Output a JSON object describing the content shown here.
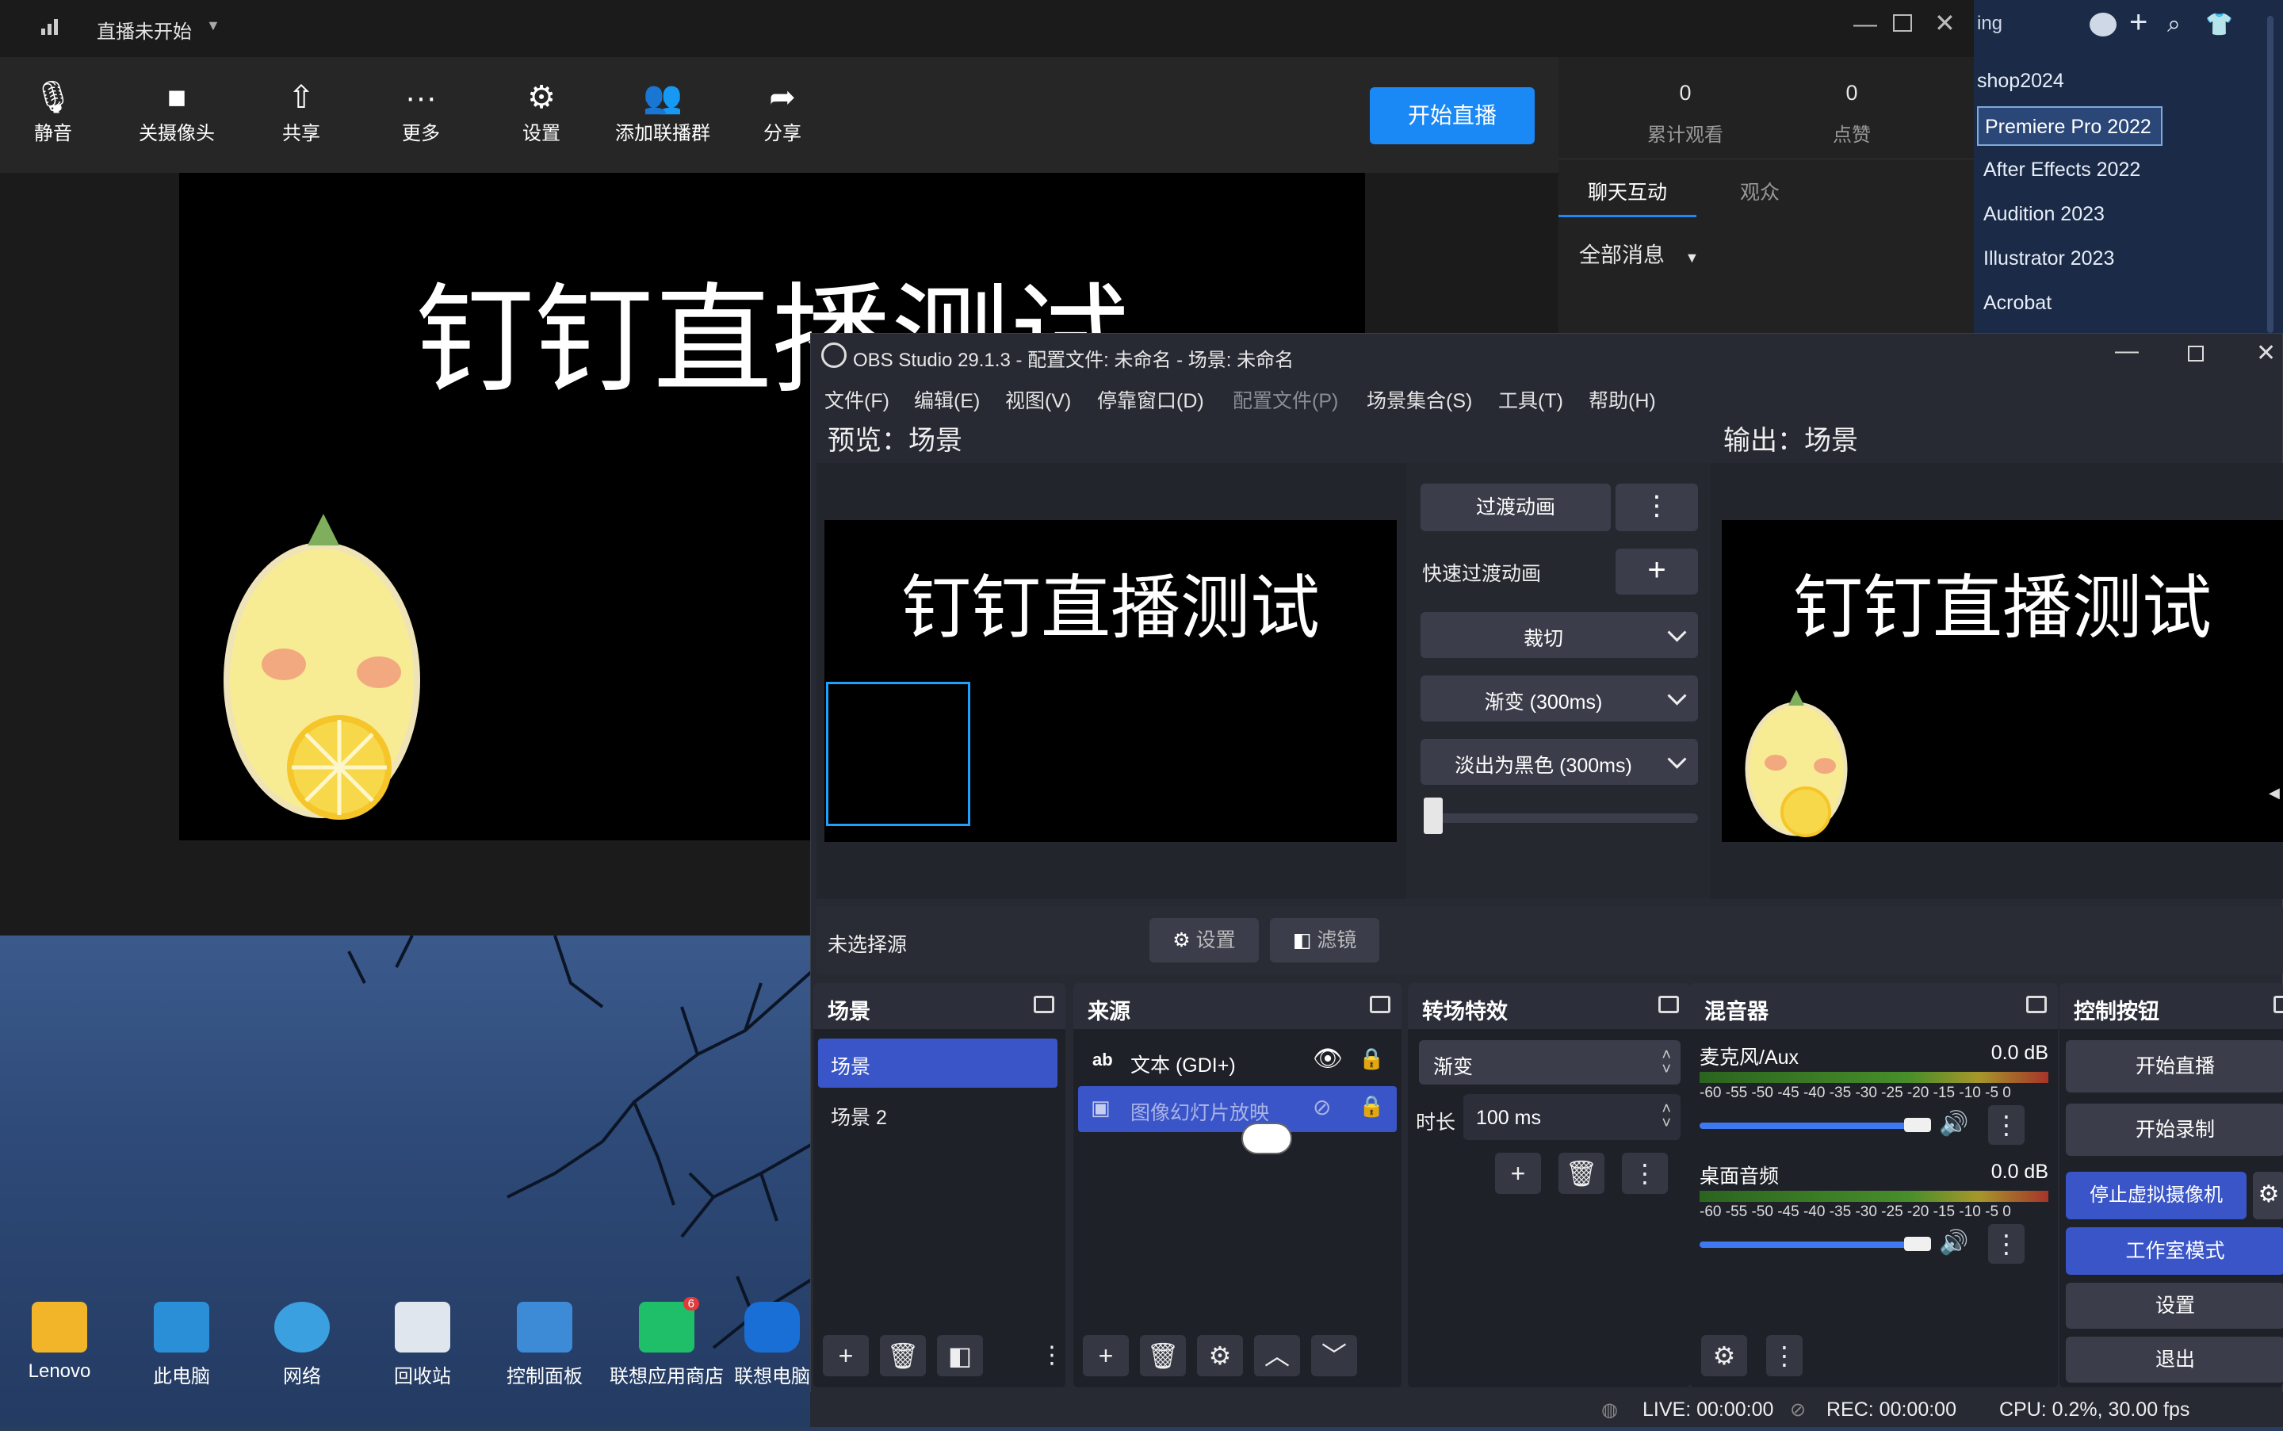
{
  "ding": {
    "status": "直播未开始",
    "toolbar": {
      "mute": "静音",
      "camera": "关摄像头",
      "share": "共享",
      "more": "更多",
      "settings": "设置",
      "add_cohost": "添加联播群",
      "share_out": "分享"
    },
    "start_live": "开始直播",
    "stats": {
      "views_value": "0",
      "views_label": "累计观看",
      "likes_value": "0",
      "likes_label": "点赞"
    },
    "tabs": {
      "chat": "聊天互动",
      "audience": "观众"
    },
    "filter": "全部消息",
    "stage_text": "钉钉直播测试"
  },
  "adobe": {
    "header_fragment": "ing",
    "items": [
      "shop2024",
      "Premiere Pro 2022",
      "After Effects 2022",
      "Audition 2023",
      "Illustrator 2023",
      "Acrobat"
    ]
  },
  "desktop": {
    "icons": [
      "Lenovo",
      "此电脑",
      "网络",
      "回收站",
      "控制面板",
      "联想应用商店",
      "联想电脑"
    ],
    "badge": "6"
  },
  "obs": {
    "title": "OBS Studio 29.1.3 - 配置文件: 未命名 - 场景: 未命名",
    "menu": [
      "文件(F)",
      "编辑(E)",
      "视图(V)",
      "停靠窗口(D)",
      "配置文件(P)",
      "场景集合(S)",
      "工具(T)",
      "帮助(H)"
    ],
    "preview_label": "预览：场景",
    "output_label": "输出：场景",
    "canvas_text": "钉钉直播测试",
    "transition": {
      "button": "过渡动画",
      "quick_label": "快速过渡动画",
      "opt1": "裁切",
      "opt2": "渐变 (300ms)",
      "opt3": "淡出为黑色 (300ms)"
    },
    "source_bar": {
      "no_source": "未选择源",
      "settings": "设置",
      "filters": "滤镜"
    },
    "docks": {
      "scenes": "场景",
      "sources": "来源",
      "transitions": "转场特效",
      "mixer": "混音器",
      "controls": "控制按钮"
    },
    "scenes": [
      "场景",
      "场景 2"
    ],
    "sources": [
      "文本 (GDI+)",
      "图像幻灯片放映"
    ],
    "trans_dock": {
      "type": "渐变",
      "duration_label": "时长",
      "duration_value": "100 ms"
    },
    "mixer": {
      "ch1_name": "麦克风/Aux",
      "ch1_db": "0.0 dB",
      "ch2_name": "桌面音频",
      "ch2_db": "0.0 dB",
      "scale": "-60 -55 -50 -45 -40 -35 -30 -25 -20 -15 -10 -5 0"
    },
    "controls": {
      "start_stream": "开始直播",
      "start_record": "开始录制",
      "virtual_cam": "停止虚拟摄像机",
      "studio_mode": "工作室模式",
      "settings": "设置",
      "exit": "退出"
    },
    "status": {
      "live": "LIVE: 00:00:00",
      "rec": "REC: 00:00:00",
      "cpu": "CPU: 0.2%, 30.00 fps"
    },
    "colors": {
      "accent": "#3a55c8",
      "ding_blue": "#1a88f5"
    }
  }
}
